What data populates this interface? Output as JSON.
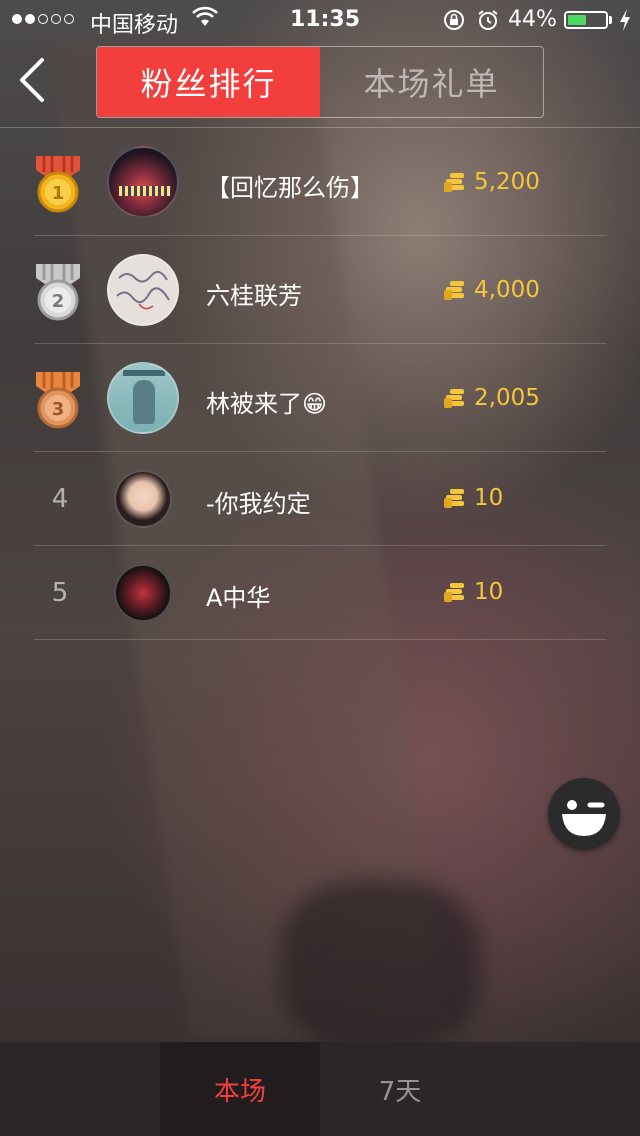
{
  "status_bar": {
    "carrier": "中国移动",
    "time": "11:35",
    "battery_percent": "44%"
  },
  "header": {
    "tabs": [
      {
        "label": "粉丝排行",
        "active": true
      },
      {
        "label": "本场礼单",
        "active": false
      }
    ]
  },
  "ranking": [
    {
      "rank": "1",
      "name": "【回忆那么伤】",
      "amount": "5,200",
      "medal": "gold"
    },
    {
      "rank": "2",
      "name": "六桂联芳",
      "amount": "4,000",
      "medal": "silver"
    },
    {
      "rank": "3",
      "name": "林被来了😁",
      "amount": "2,005",
      "medal": "bronze"
    },
    {
      "rank": "4",
      "name": "-你我约定",
      "amount": "10",
      "medal": ""
    },
    {
      "rank": "5",
      "name": "A中华",
      "amount": "10",
      "medal": ""
    }
  ],
  "bottom_tabs": [
    {
      "label": "本场",
      "active": true
    },
    {
      "label": "7天",
      "active": false
    }
  ],
  "colors": {
    "accent": "#f33e3e",
    "coin": "#f6c63a",
    "battery": "#4cd964"
  },
  "icons": {
    "back": "chevron-left-icon",
    "coin": "coin-stack-icon",
    "emoji": "wink-face-icon"
  }
}
